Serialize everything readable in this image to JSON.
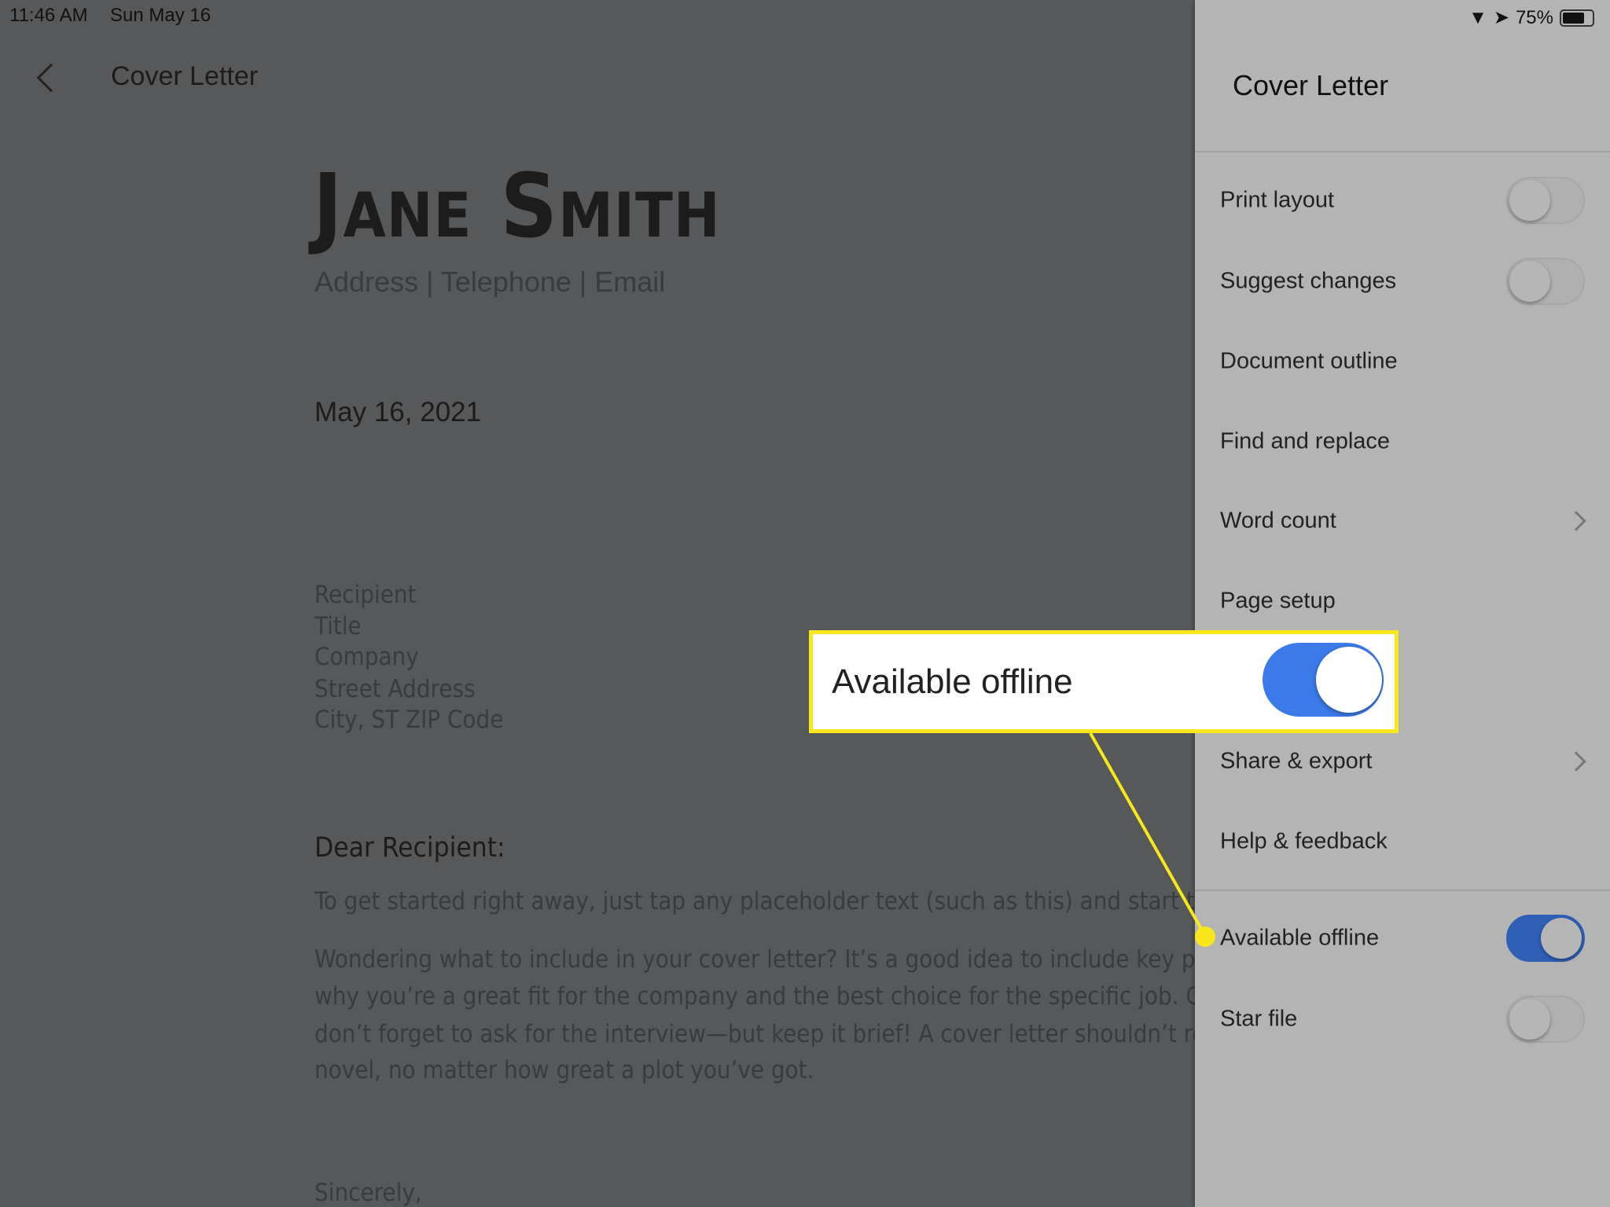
{
  "status_bar": {
    "time": "11:46 AM",
    "date": "Sun May 16",
    "battery": "75%",
    "icons": [
      "wifi-icon",
      "location-icon",
      "battery-icon"
    ]
  },
  "header": {
    "title": "Cover Letter",
    "back_icon": "chevron-left-icon"
  },
  "document": {
    "name": "Jane Smith",
    "contact": "Address | Telephone | Email",
    "date": "May 16, 2021",
    "recipient": [
      "Recipient",
      "Title",
      "Company",
      "Street Address",
      "City, ST ZIP Code"
    ],
    "salutation": "Dear Recipient:",
    "para1": "To get started right away, just tap any placeholder text (such as this) and start typi",
    "para2": [
      "Wondering what to include in your cover letter? It’s a good idea to include key points",
      "why you’re a great fit for the company and the best choice for the specific job. Of co",
      "don’t forget to ask for the interview—but keep it brief! A cover letter shouldn’t read l",
      "novel, no matter how great a plot you’ve got."
    ],
    "closing": "Sincerely,"
  },
  "panel": {
    "title": "Cover Letter",
    "items": [
      {
        "label": "Print layout",
        "toggle": false
      },
      {
        "label": "Suggest changes",
        "toggle": false
      },
      {
        "label": "Document outline"
      },
      {
        "label": "Find and replace"
      },
      {
        "label": "Word count",
        "chevron": true
      },
      {
        "label": "Page setup"
      },
      {
        "label": "Share & export",
        "chevron": true
      },
      {
        "label": "Help & feedback"
      },
      {
        "label": "Available offline",
        "toggle": true
      },
      {
        "label": "Star file",
        "toggle": false
      }
    ]
  },
  "callout": {
    "label": "Available offline",
    "toggle": true,
    "border_color": "#f8e71c",
    "toggle_color": "#3b7ae8"
  }
}
